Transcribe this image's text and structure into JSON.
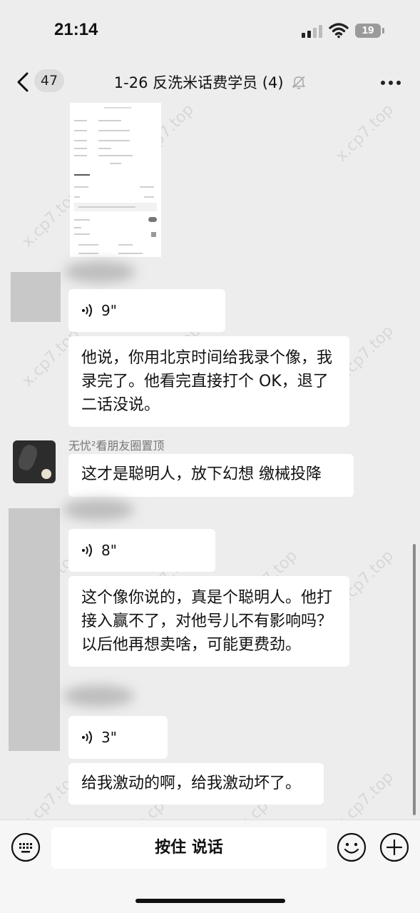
{
  "status_bar": {
    "time": "21:14",
    "battery": "19"
  },
  "header": {
    "unread_count": "47",
    "title": "1-26 反洗米话费学员 (4)"
  },
  "messages": {
    "voice1": "9\"",
    "text1": "他说，你用北京时间给我录个像，我录完了。他看完直接打个 OK，退了二话没说。",
    "sender_name": "无忧²看朋友圈置顶",
    "text2": "这才是聪明人，放下幻想 缴械投降",
    "voice2": "8\"",
    "text3": "这个像你说的，真是个聪明人。他打接入赢不了，对他号儿不有影响吗？以后他再想卖啥，可能更费劲。",
    "voice3": "3\"",
    "text4": "给我激动的啊，给我激动坏了。"
  },
  "input_bar": {
    "hold_to_talk": "按住 说话"
  },
  "watermark": "x.cp7.top",
  "colors": {
    "background": "#ededed",
    "bubble": "#ffffff",
    "input_bar": "#f6f6f6"
  }
}
